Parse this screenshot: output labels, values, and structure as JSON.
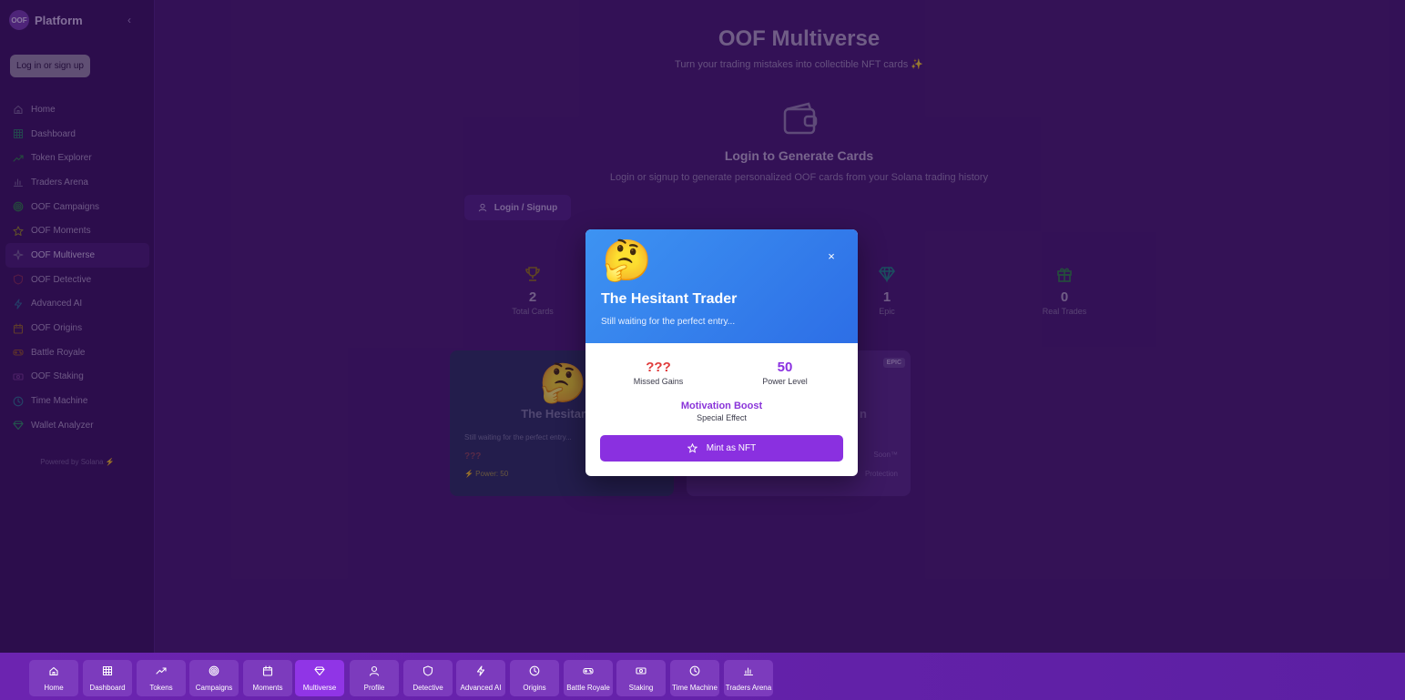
{
  "sidebar": {
    "brand_logo": "OOF",
    "brand_name": "Platform",
    "collapse": "‹",
    "login_label": "Log in or sign up",
    "items": [
      {
        "label": "Home",
        "icon": "home-icon"
      },
      {
        "label": "Dashboard",
        "icon": "grid-icon"
      },
      {
        "label": "Token Explorer",
        "icon": "trending-up-icon"
      },
      {
        "label": "Traders Arena",
        "icon": "bar-chart-icon"
      },
      {
        "label": "OOF Campaigns",
        "icon": "target-icon"
      },
      {
        "label": "OOF Moments",
        "icon": "star-icon"
      },
      {
        "label": "OOF Multiverse",
        "icon": "sparkles-icon"
      },
      {
        "label": "OOF Detective",
        "icon": "shield-icon"
      },
      {
        "label": "Advanced AI",
        "icon": "zap-icon"
      },
      {
        "label": "OOF Origins",
        "icon": "calendar-icon"
      },
      {
        "label": "Battle Royale",
        "icon": "gamepad-icon"
      },
      {
        "label": "OOF Staking",
        "icon": "coins-icon"
      },
      {
        "label": "Time Machine",
        "icon": "clock-icon"
      },
      {
        "label": "Wallet Analyzer",
        "icon": "gem-icon"
      }
    ],
    "active_index": 6,
    "powered_by": "Powered by Solana ⚡"
  },
  "main": {
    "title": "OOF Multiverse",
    "subtitle": "Turn your trading mistakes into collectible NFT cards ✨",
    "login_title": "Login to Generate Cards",
    "login_desc": "Login or signup to generate personalized OOF cards from your Solana trading history",
    "login_button": "Login / Signup",
    "stats": [
      {
        "value": "2",
        "label": "Total Cards",
        "icon": "trophy-icon",
        "color": "#9a7a1c"
      },
      {
        "value": "1",
        "label": "Epic",
        "icon": "gem-icon",
        "color": "#1f8a8a"
      },
      {
        "value": "0",
        "label": "Real Trades",
        "icon": "gift-icon",
        "color": "#2f8a4a"
      }
    ],
    "cards": [
      {
        "emoji": "🤔",
        "title": "The Hesitant T",
        "desc": "Still waiting for the perfect entry...",
        "missed": "???",
        "power": "⚡ Power: 50"
      },
      {
        "badge": "EPIC",
        "title": "n",
        "soon": "Soon™",
        "effect": "Protection"
      }
    ]
  },
  "modal": {
    "emoji": "🤔",
    "close": "×",
    "title": "The Hesitant Trader",
    "desc": "Still waiting for the perfect entry...",
    "missed_value": "???",
    "missed_label": "Missed Gains",
    "power_value": "50",
    "power_label": "Power Level",
    "effect_name": "Motivation Boost",
    "effect_label": "Special Effect",
    "mint_label": "Mint as NFT",
    "colors": {
      "missed": "#e03b3b",
      "power": "#8a30e0",
      "button": "#8a30e0"
    }
  },
  "bottom_nav": [
    {
      "label": "Home",
      "icon": "home-icon"
    },
    {
      "label": "Dashboard",
      "icon": "grid-icon"
    },
    {
      "label": "Tokens",
      "icon": "trending-up-icon"
    },
    {
      "label": "Campaigns",
      "icon": "target-icon"
    },
    {
      "label": "Moments",
      "icon": "calendar-icon"
    },
    {
      "label": "Multiverse",
      "icon": "gem-icon",
      "active": true
    },
    {
      "label": "Profile",
      "icon": "user-icon"
    },
    {
      "label": "Detective",
      "icon": "shield-icon"
    },
    {
      "label": "Advanced AI",
      "icon": "zap-icon"
    },
    {
      "label": "Origins",
      "icon": "clock-icon"
    },
    {
      "label": "Battle Royale",
      "icon": "gamepad-icon"
    },
    {
      "label": "Staking",
      "icon": "coins-icon"
    },
    {
      "label": "Time Machine",
      "icon": "clock-icon"
    },
    {
      "label": "Traders Arena",
      "icon": "bar-chart-icon"
    }
  ]
}
